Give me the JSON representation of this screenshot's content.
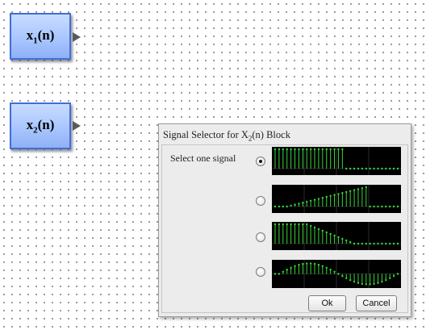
{
  "canvas": {
    "blocks": [
      {
        "label_base": "x",
        "label_sub": "1",
        "label_tail": "(n)"
      },
      {
        "label_base": "x",
        "label_sub": "2",
        "label_tail": "(n)"
      }
    ]
  },
  "dialog": {
    "title_pre": "Signal Selector for X",
    "title_sub": "2",
    "title_post": "(n) Block",
    "prompt": "Select one signal",
    "selected_index": 0,
    "options": [
      {
        "signal": "step-then-zero",
        "selected": true
      },
      {
        "signal": "ramp-up-then-zero",
        "selected": false
      },
      {
        "signal": "ramp-down",
        "selected": false
      },
      {
        "signal": "sine-period",
        "selected": false
      }
    ],
    "ok_label": "Ok",
    "cancel_label": "Cancel"
  },
  "colors": {
    "block_border": "#3f6fd8",
    "stem": "#39d639",
    "thumb_bg": "#000000",
    "grid": "#4a4a4a"
  }
}
